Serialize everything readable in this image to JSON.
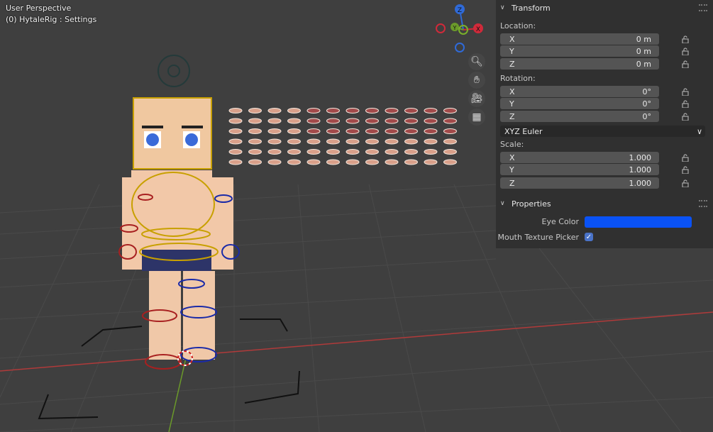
{
  "viewport": {
    "title": "User Perspective",
    "subtitle": "(0) HytaleRig : Settings",
    "gizmo": {
      "z": "Z",
      "y": "Y",
      "x": "X"
    },
    "nav_icons": [
      "zoom-icon",
      "hand-icon",
      "camera-icon",
      "grid-icon"
    ]
  },
  "transform": {
    "header": "Transform",
    "location_label": "Location:",
    "location": [
      {
        "axis": "X",
        "value": "0 m"
      },
      {
        "axis": "Y",
        "value": "0 m"
      },
      {
        "axis": "Z",
        "value": "0 m"
      }
    ],
    "rotation_label": "Rotation:",
    "rotation": [
      {
        "axis": "X",
        "value": "0°"
      },
      {
        "axis": "Y",
        "value": "0°"
      },
      {
        "axis": "Z",
        "value": "0°"
      }
    ],
    "rotation_mode": "XYZ Euler",
    "scale_label": "Scale:",
    "scale": [
      {
        "axis": "X",
        "value": "1.000"
      },
      {
        "axis": "Y",
        "value": "1.000"
      },
      {
        "axis": "Z",
        "value": "1.000"
      }
    ]
  },
  "properties": {
    "header": "Properties",
    "eye_color_label": "Eye Color",
    "eye_color": "#0a52f5",
    "mouth_picker_label": "Mouth Texture Picker",
    "mouth_picker_checked": true
  }
}
